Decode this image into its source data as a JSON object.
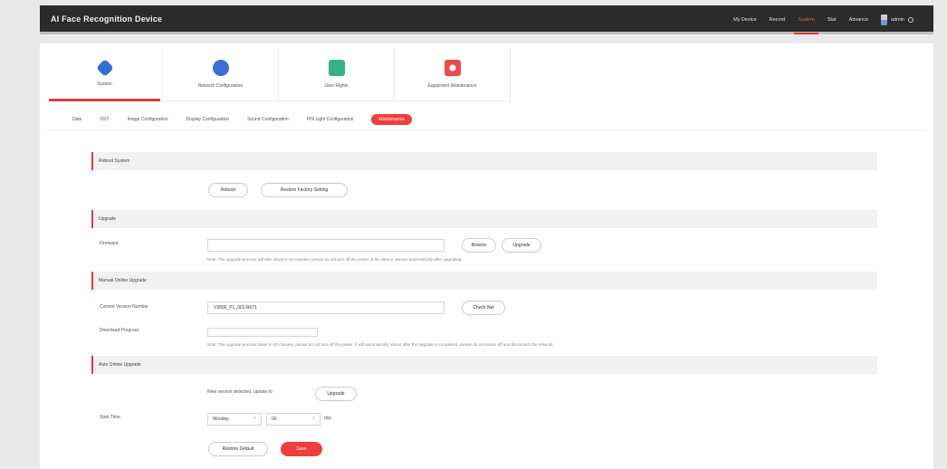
{
  "header": {
    "title": "AI Face Recognition Device",
    "nav": [
      "My Device",
      "Record",
      "System",
      "Stat",
      "Advance"
    ],
    "active_nav": "System",
    "user": "admin"
  },
  "modules": [
    {
      "label": "System",
      "icon": "gear-icon",
      "active": true
    },
    {
      "label": "Network Configuration",
      "icon": "network-icon",
      "active": false
    },
    {
      "label": "User Rights",
      "icon": "shield-icon",
      "active": false
    },
    {
      "label": "Equipment Maintenance",
      "icon": "maintenance-icon",
      "active": false
    }
  ],
  "subtabs": [
    "Date",
    "DST",
    "Image Configuration",
    "Display Configuration",
    "Sound Configuration",
    "PIN Light Configuration",
    "Maintenance"
  ],
  "active_subtab": "Maintenance",
  "reboot": {
    "title": "Reboot System",
    "reboot_btn": "Reboot",
    "restore_btn": "Restore Factory Setting"
  },
  "upgrade": {
    "title": "Upgrade",
    "firmware_label": "Firmware",
    "firmware_value": "",
    "browse_btn": "Browse",
    "upgrade_btn": "Upgrade",
    "note": "Note: The upgrade process will take about 5~10 minutes, please do not turn off the power of the device. Device automatically after upgrading."
  },
  "manual_upgrade": {
    "title": "Manual Online Upgrade",
    "version_label": "Current Version Number",
    "version_value": "V3000_P1_001.R071",
    "check_btn": "Check Net",
    "progress_label": "Download Progress",
    "note": "Note: The upgrade process takes 5~10 minutes, please do not turn off the power. It will automatically reboot after the upgrade is completed, please do not power off and disconnect the network."
  },
  "auto_upgrade": {
    "title": "Auto Online Upgrade",
    "detected_text": "New version detected, update to",
    "upgrade_btn": "Upgrade",
    "time_label": "Start Time",
    "day_value": "Monday",
    "hour_value": "00",
    "unit": "day",
    "restore_btn": "Restore Default",
    "save_btn": "Save"
  }
}
